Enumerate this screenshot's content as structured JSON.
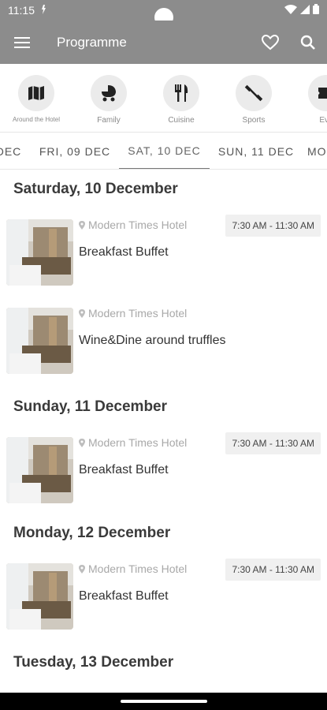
{
  "status_bar": {
    "time": "11:15"
  },
  "app_bar": {
    "title": "Programme",
    "icons": [
      "menu-icon",
      "heart-icon",
      "search-icon"
    ]
  },
  "categories": [
    {
      "label": "Around the Hotel",
      "icon": "map-icon"
    },
    {
      "label": "Family",
      "icon": "stroller-icon"
    },
    {
      "label": "Cuisine",
      "icon": "cutlery-icon"
    },
    {
      "label": "Sports",
      "icon": "dumbbell-icon"
    },
    {
      "label": "Eve",
      "icon": "ticket-icon"
    }
  ],
  "date_tabs": [
    {
      "label": "DEC"
    },
    {
      "label": "FRI, 09 DEC"
    },
    {
      "label": "SAT, 10 DEC",
      "selected": true
    },
    {
      "label": "SUN, 11 DEC"
    },
    {
      "label": "MO"
    }
  ],
  "days": [
    {
      "heading": "Saturday, 10 December",
      "events": [
        {
          "location": "Modern Times Hotel",
          "time": "7:30 AM - 11:30 AM",
          "title": "Breakfast Buffet"
        },
        {
          "location": "Modern Times Hotel",
          "time": "",
          "title": "Wine&Dine around truffles"
        }
      ]
    },
    {
      "heading": "Sunday, 11 December",
      "events": [
        {
          "location": "Modern Times Hotel",
          "time": "7:30 AM - 11:30 AM",
          "title": "Breakfast Buffet"
        }
      ]
    },
    {
      "heading": "Monday, 12 December",
      "events": [
        {
          "location": "Modern Times Hotel",
          "time": "7:30 AM - 11:30 AM",
          "title": "Breakfast Buffet"
        }
      ]
    },
    {
      "heading": "Tuesday, 13 December",
      "events": []
    }
  ],
  "colors": {
    "app_bar": "#8c8c8c",
    "category_circle": "#ebebeb",
    "time_badge": "#f0f0f0"
  }
}
